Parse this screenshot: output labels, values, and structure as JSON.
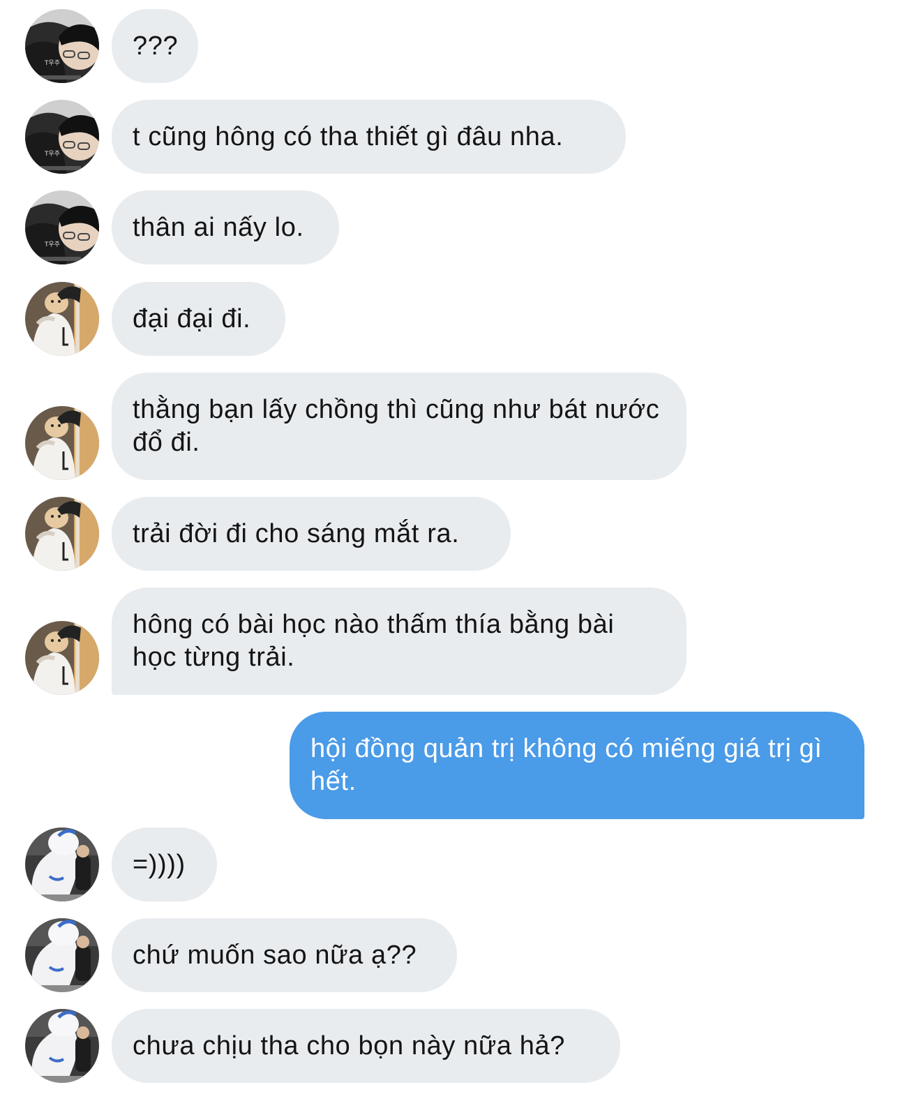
{
  "conversation": {
    "messages": [
      {
        "text": "???",
        "direction": "incoming",
        "avatar": "avatar-sketch-person"
      },
      {
        "text": "t cũng hông có tha thiết gì đâu nha.",
        "direction": "incoming",
        "avatar": "avatar-sketch-person"
      },
      {
        "text": "thân ai nấy lo.",
        "direction": "incoming",
        "avatar": "avatar-sketch-person"
      },
      {
        "text": "đại đại đi.",
        "direction": "incoming",
        "avatar": "avatar-person-with-dog"
      },
      {
        "text": "thằng bạn lấy chồng thì cũng như bát nước đổ đi.",
        "direction": "incoming",
        "avatar": "avatar-person-with-dog"
      },
      {
        "text": "trải đời đi cho sáng mắt ra.",
        "direction": "incoming",
        "avatar": "avatar-person-with-dog"
      },
      {
        "text": "hông có bài học nào thấm thía bằng bài học từng trải.",
        "direction": "incoming",
        "avatar": "avatar-person-with-dog"
      },
      {
        "text": "hội đồng quản trị không có miếng giá trị gì hết.",
        "direction": "outgoing",
        "avatar": ""
      },
      {
        "text": "=))))",
        "direction": "incoming",
        "avatar": "avatar-person-with-mascot"
      },
      {
        "text": "chứ muốn sao nữa ạ??",
        "direction": "incoming",
        "avatar": "avatar-person-with-mascot"
      },
      {
        "text": "chưa chịu tha cho bọn này nữa hả?",
        "direction": "incoming",
        "avatar": "avatar-person-with-mascot"
      }
    ]
  },
  "colors": {
    "incoming_bubble": "#e9ecef",
    "outgoing_bubble": "#4a9be8",
    "incoming_text": "#141414",
    "outgoing_text": "#ffffff"
  }
}
